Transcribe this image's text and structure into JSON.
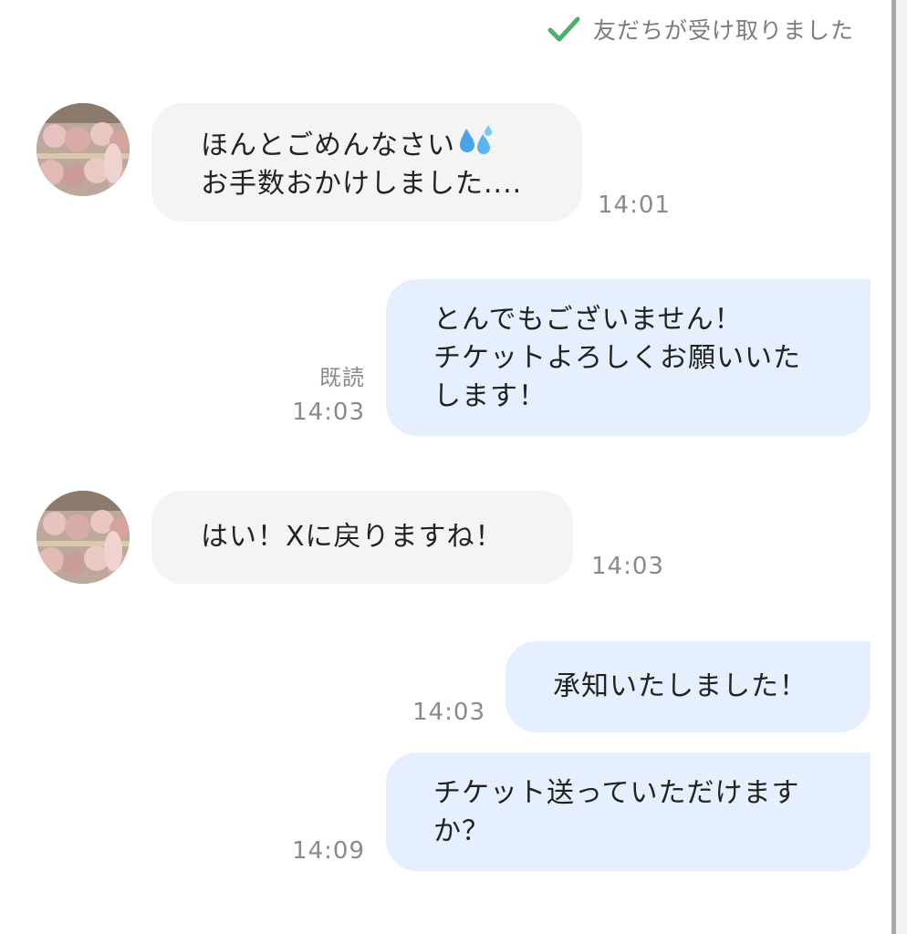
{
  "chat": {
    "received_notice": "友だちが受け取りました",
    "messages": [
      {
        "side": "in",
        "lines": [
          "ほんとごめんなさい",
          "お手数おかけしました...."
        ],
        "time": "14:01"
      },
      {
        "side": "out",
        "lines": [
          "とんでもございません！",
          "チケットよろしくお願いいた",
          "します！"
        ],
        "read": "既読",
        "time": "14:03"
      },
      {
        "side": "in",
        "lines": [
          "はい！Xに戻りますね！"
        ],
        "time": "14:03"
      },
      {
        "side": "out",
        "lines": [
          "承知いたしました！"
        ],
        "time": "14:03"
      },
      {
        "side": "out",
        "lines": [
          "チケット送っていただけます",
          "か？"
        ],
        "time": "14:09"
      }
    ]
  },
  "icons": {
    "check": "checkmark-icon",
    "avatar": "plush-toys-avatar",
    "emoji": "sweat-droplets-emoji"
  },
  "colors": {
    "check_green": "#4caf6a",
    "incoming_bubble": "#f4f4f4",
    "outgoing_bubble": "#e5effd",
    "meta_text": "#8a8a8a"
  }
}
